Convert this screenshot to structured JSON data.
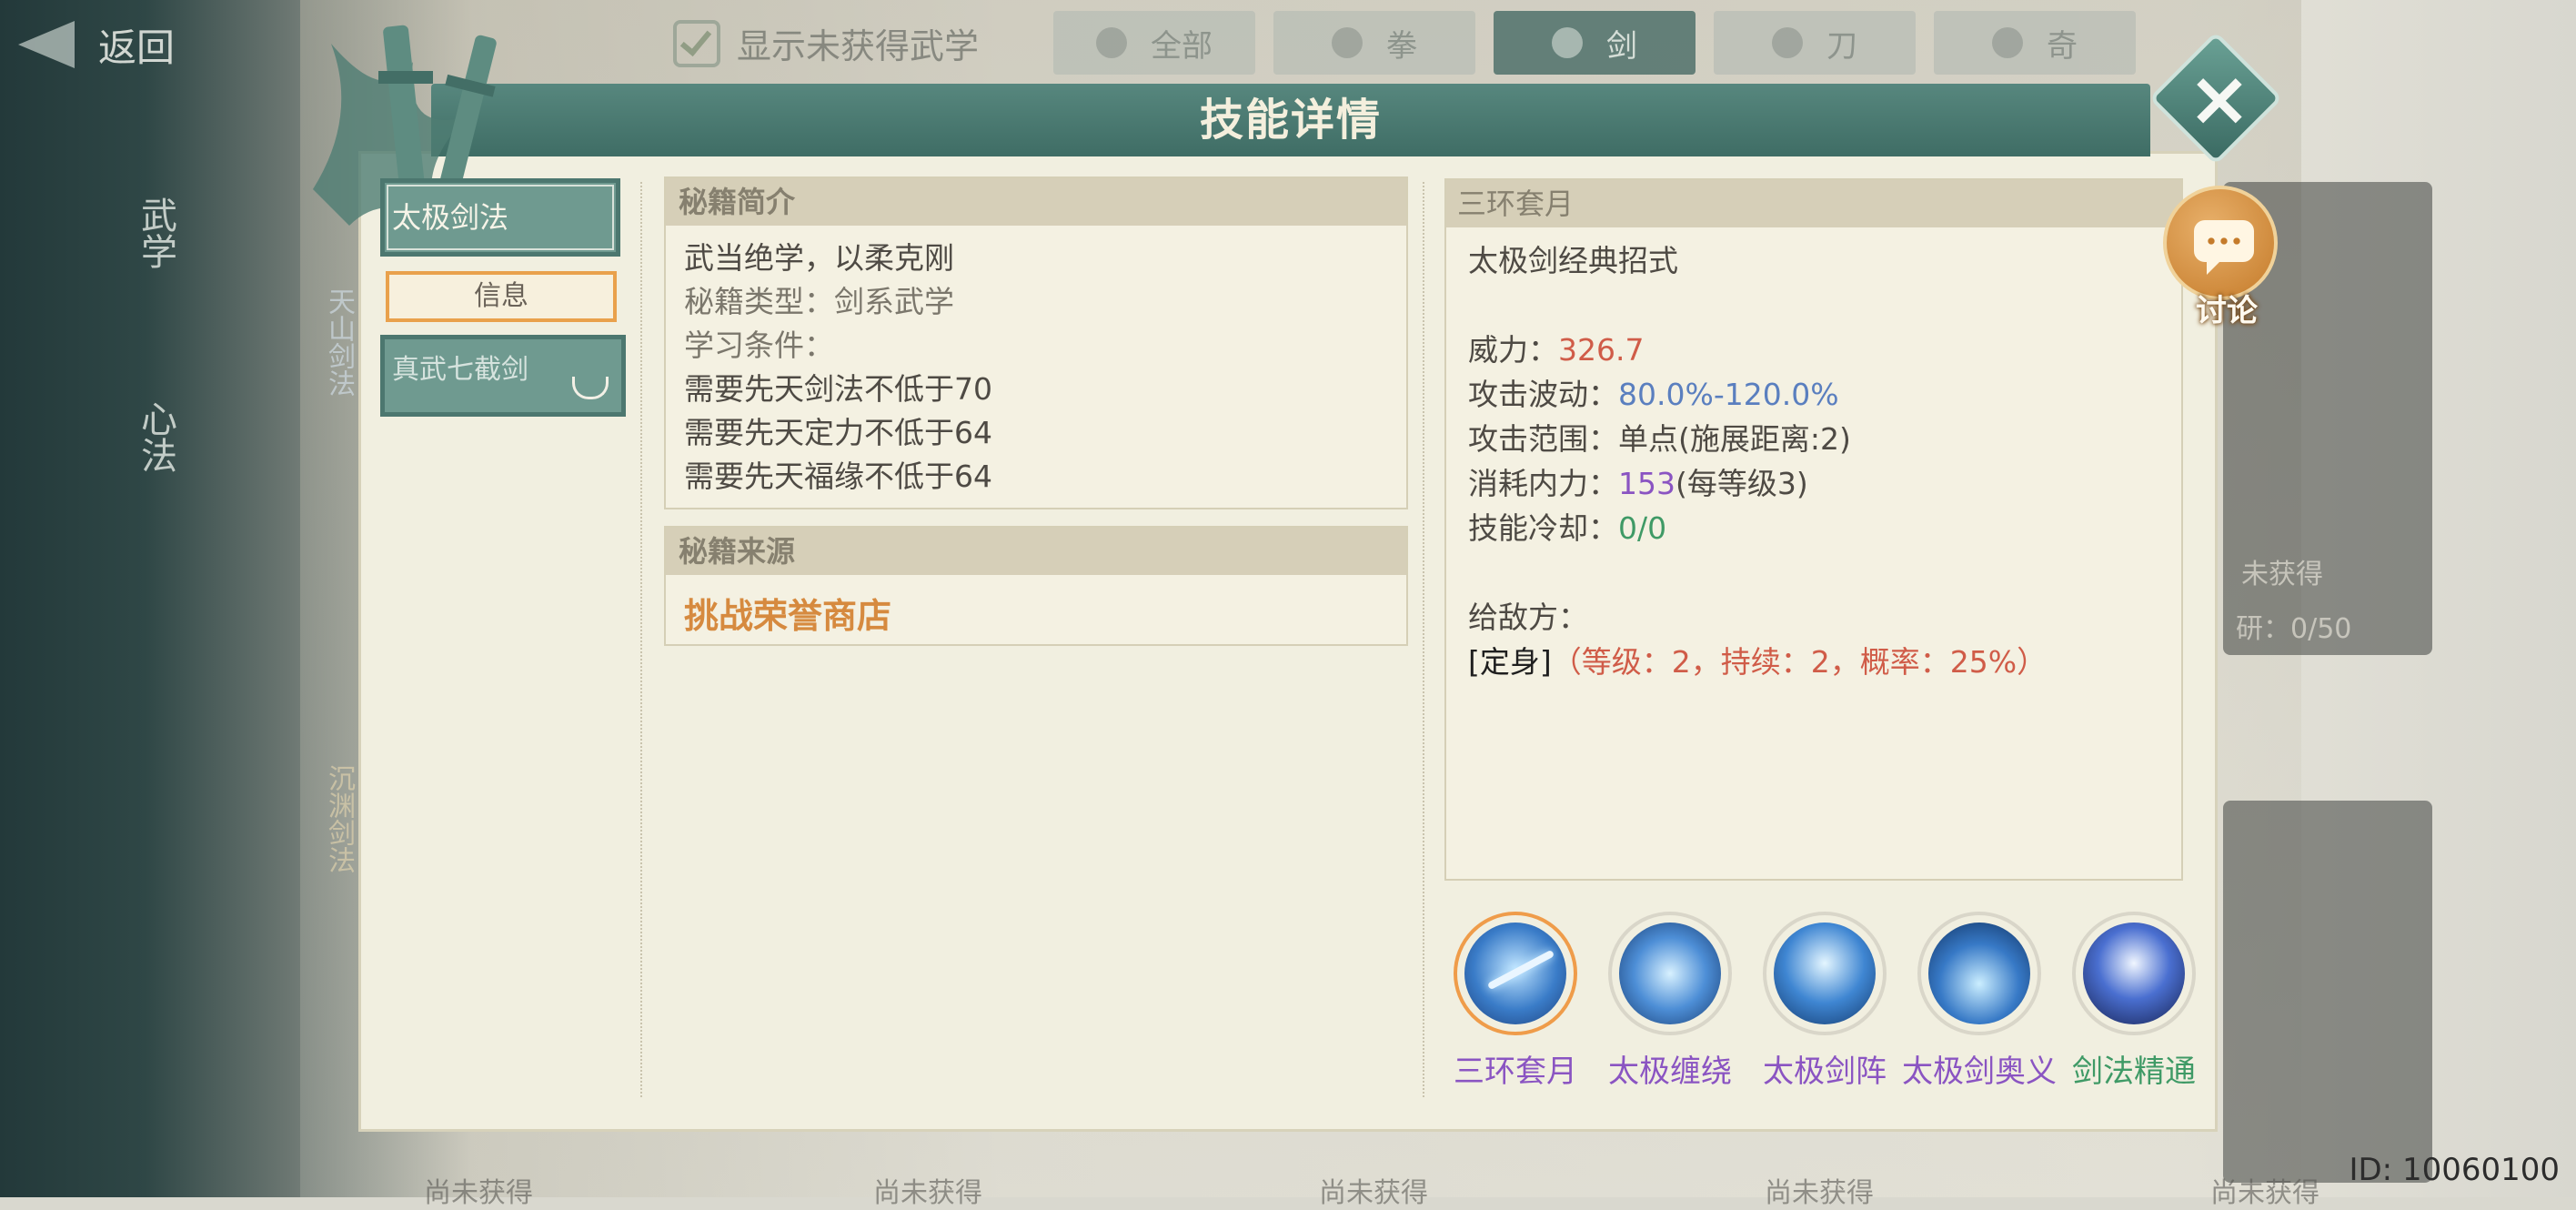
{
  "background": {
    "back_label": "返回",
    "filter_label": "显示未获得武学",
    "tabs": [
      {
        "label": "全部",
        "active": false
      },
      {
        "label": "拳",
        "active": false
      },
      {
        "label": "剑",
        "active": true
      },
      {
        "label": "刀",
        "active": false
      },
      {
        "label": "奇",
        "active": false
      }
    ],
    "side_tabs": [
      "武学",
      "心法"
    ],
    "cards": [
      {
        "name": "天山剑法"
      },
      {
        "name": "沉渊剑法"
      }
    ],
    "card_status": "未获得",
    "card_progress": "研：0/50",
    "bottom_labels": [
      "尚未获得",
      "尚未获得",
      "尚未获得",
      "尚未获得",
      "尚未获得"
    ]
  },
  "modal": {
    "title": "技能详情",
    "left": {
      "selected_tab": "太极剑法",
      "info_tab": "信息",
      "second_tab": "真武七截剑"
    },
    "intro": {
      "header": "秘籍简介",
      "desc": "武当绝学，以柔克刚",
      "type_label": "秘籍类型：剑系武学",
      "req_label": "学习条件：",
      "reqs": [
        "需要先天剑法不低于70",
        "需要先天定力不低于64",
        "需要先天福缘不低于64"
      ]
    },
    "source": {
      "header": "秘籍来源",
      "link": "挑战荣誉商店"
    },
    "detail": {
      "header": "三环套月",
      "desc": "太极剑经典招式",
      "power_label": "威力：",
      "power_value": "326.7",
      "wave_label": "攻击波动：",
      "wave_value": "80.0%-120.0%",
      "range_label": "攻击范围：",
      "range_value": "单点(施展距离:2)",
      "mp_label": "消耗内力：",
      "mp_value": "153",
      "mp_suffix": "(每等级3)",
      "cd_label": "技能冷却：",
      "cd_value": "0/0",
      "enemy_label": "给敌方：",
      "effect_name": "[定身]",
      "effect_detail": "（等级：2，持续：2，概率：25%）"
    },
    "skills": [
      {
        "name": "三环套月",
        "color": "#8a54c2",
        "selected": true,
        "icon": "sword-slash-icon"
      },
      {
        "name": "太极缠绕",
        "color": "#8a54c2",
        "selected": false,
        "icon": "sword-spin-icon"
      },
      {
        "name": "太极剑阵",
        "color": "#8a54c2",
        "selected": false,
        "icon": "sword-array-icon"
      },
      {
        "name": "太极剑奥义",
        "color": "#8a54c2",
        "selected": false,
        "icon": "sword-mystery-icon"
      },
      {
        "name": "剑法精通",
        "color": "#3f9a66",
        "selected": false,
        "icon": "sword-master-icon"
      }
    ],
    "discuss_label": "讨论"
  },
  "id_text": "ID: 10060100"
}
